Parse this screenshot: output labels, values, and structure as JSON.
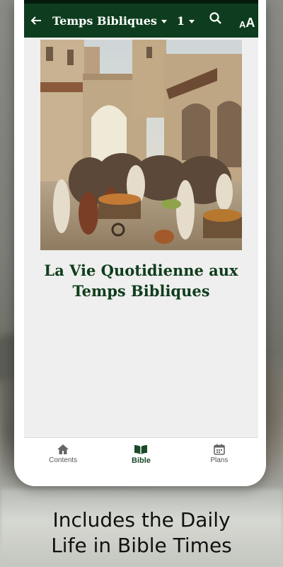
{
  "app_bar": {
    "book": "Temps Bibliques",
    "chapter": "1",
    "font_button_small": "A",
    "font_button_large": "A",
    "color": "#0d3d1e"
  },
  "content": {
    "chapter_title_line1": "La Vie Quotidienne aux",
    "chapter_title_line2": "Temps Bibliques",
    "illustration": "ancient-market-street-painting"
  },
  "bottom_nav": {
    "items": [
      {
        "label": "Contents",
        "icon": "home-icon",
        "active": false
      },
      {
        "label": "Bible",
        "icon": "open-book-icon",
        "active": true
      },
      {
        "label": "Plans",
        "icon": "calendar-icon",
        "active": false
      }
    ]
  },
  "caption": {
    "line1": "Includes the Daily",
    "line2": "Life in Bible Times"
  }
}
